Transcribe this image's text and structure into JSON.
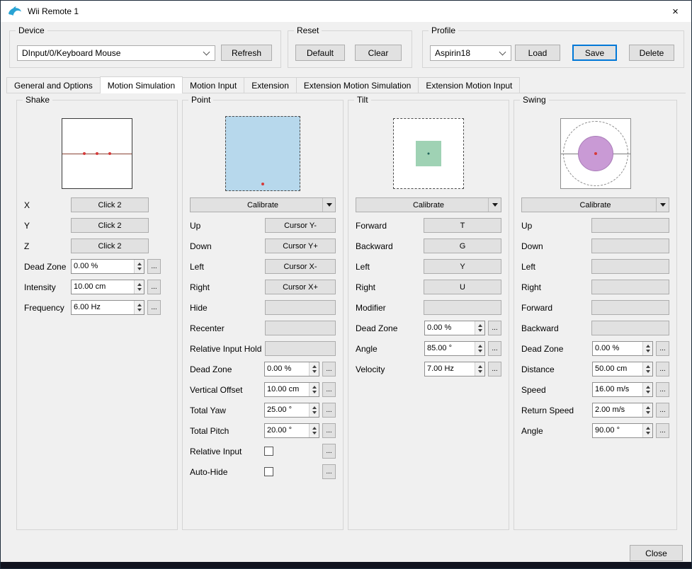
{
  "colors": {
    "accent": "#0078d7",
    "point_area_fill": "#b7d8ec",
    "tilt_square_fill": "#9fd2b4",
    "swing_circle_fill": "#c99ad5",
    "indicator_dot": "#d63a3a"
  },
  "icons": {
    "app": "dolphin",
    "close": "×",
    "advanced": "..."
  },
  "titlebar": {
    "title": "Wii Remote 1"
  },
  "device": {
    "label": "Device",
    "selected": "DInput/0/Keyboard Mouse",
    "refresh_label": "Refresh"
  },
  "reset": {
    "label": "Reset",
    "default_label": "Default",
    "clear_label": "Clear"
  },
  "profile": {
    "label": "Profile",
    "selected": "Aspirin18",
    "load_label": "Load",
    "save_label": "Save",
    "delete_label": "Delete"
  },
  "tabs": [
    {
      "label": "General and Options",
      "active": false
    },
    {
      "label": "Motion Simulation",
      "active": true
    },
    {
      "label": "Motion Input",
      "active": false
    },
    {
      "label": "Extension",
      "active": false
    },
    {
      "label": "Extension Motion Simulation",
      "active": false
    },
    {
      "label": "Extension Motion Input",
      "active": false
    }
  ],
  "shake": {
    "title": "Shake",
    "buttons": [
      {
        "label": "X",
        "value": "Click 2"
      },
      {
        "label": "Y",
        "value": "Click 2"
      },
      {
        "label": "Z",
        "value": "Click 2"
      }
    ],
    "spins": [
      {
        "label": "Dead Zone",
        "value": "0.00 %"
      },
      {
        "label": "Intensity",
        "value": "10.00 cm"
      },
      {
        "label": "Frequency",
        "value": "6.00 Hz"
      }
    ]
  },
  "point": {
    "title": "Point",
    "calibrate_label": "Calibrate",
    "buttons": [
      {
        "label": "Up",
        "value": "Cursor Y-"
      },
      {
        "label": "Down",
        "value": "Cursor Y+"
      },
      {
        "label": "Left",
        "value": "Cursor X-"
      },
      {
        "label": "Right",
        "value": "Cursor X+"
      },
      {
        "label": "Hide",
        "value": ""
      },
      {
        "label": "Recenter",
        "value": ""
      },
      {
        "label": "Relative Input Hold",
        "value": ""
      }
    ],
    "spins": [
      {
        "label": "Dead Zone",
        "value": "0.00 %"
      },
      {
        "label": "Vertical Offset",
        "value": "10.00 cm"
      },
      {
        "label": "Total Yaw",
        "value": "25.00 °"
      },
      {
        "label": "Total Pitch",
        "value": "20.00 °"
      }
    ],
    "checks": [
      {
        "label": "Relative Input",
        "checked": false
      },
      {
        "label": "Auto-Hide",
        "checked": false
      }
    ]
  },
  "tilt": {
    "title": "Tilt",
    "calibrate_label": "Calibrate",
    "buttons": [
      {
        "label": "Forward",
        "value": "T"
      },
      {
        "label": "Backward",
        "value": "G"
      },
      {
        "label": "Left",
        "value": "Y"
      },
      {
        "label": "Right",
        "value": "U"
      },
      {
        "label": "Modifier",
        "value": ""
      }
    ],
    "spins": [
      {
        "label": "Dead Zone",
        "value": "0.00 %"
      },
      {
        "label": "Angle",
        "value": "85.00 °"
      },
      {
        "label": "Velocity",
        "value": "7.00 Hz"
      }
    ]
  },
  "swing": {
    "title": "Swing",
    "calibrate_label": "Calibrate",
    "buttons": [
      {
        "label": "Up",
        "value": ""
      },
      {
        "label": "Down",
        "value": ""
      },
      {
        "label": "Left",
        "value": ""
      },
      {
        "label": "Right",
        "value": ""
      },
      {
        "label": "Forward",
        "value": ""
      },
      {
        "label": "Backward",
        "value": ""
      }
    ],
    "spins": [
      {
        "label": "Dead Zone",
        "value": "0.00 %"
      },
      {
        "label": "Distance",
        "value": "50.00 cm"
      },
      {
        "label": "Speed",
        "value": "16.00 m/s"
      },
      {
        "label": "Return Speed",
        "value": "2.00 m/s"
      },
      {
        "label": "Angle",
        "value": "90.00 °"
      }
    ]
  },
  "footer": {
    "close_label": "Close"
  }
}
